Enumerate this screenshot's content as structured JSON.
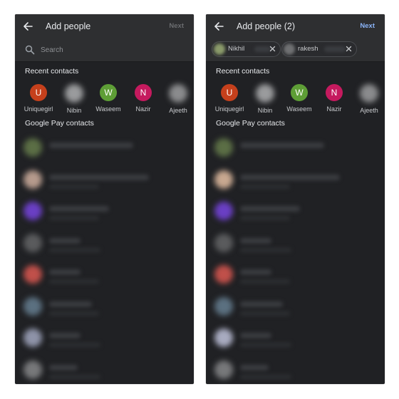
{
  "screens": [
    {
      "header": {
        "title": "Add people",
        "next_label": "Next",
        "next_enabled": false
      },
      "search": {
        "placeholder": "Search",
        "value": ""
      },
      "selected_chips": [],
      "recent_contacts_label": "Recent contacts",
      "recent_contacts": [
        {
          "name": "Uniquegirl",
          "initial": "U",
          "color": "#c5401c",
          "photo": false
        },
        {
          "name": "Nibin",
          "initial": "",
          "color": "#9a9b9d",
          "photo": true
        },
        {
          "name": "Waseem",
          "initial": "W",
          "color": "#5e9e36",
          "photo": false
        },
        {
          "name": "Nazir",
          "initial": "N",
          "color": "#c51a5e",
          "photo": false
        },
        {
          "name": "Ajeeth",
          "initial": "",
          "color": "#8a8b8d",
          "photo": true
        }
      ],
      "gpay_contacts_label": "Google Pay contacts",
      "gpay_contacts": [
        {
          "avatar_color": "#5b6e45",
          "blurred": true
        },
        {
          "avatar_color": "#b59a8c",
          "blurred": true
        },
        {
          "avatar_color": "#6a3fc4",
          "blurred": true
        },
        {
          "avatar_color": "#5a5b5d",
          "blurred": true
        },
        {
          "avatar_color": "#c0504a",
          "blurred": true
        },
        {
          "avatar_color": "#5b7080",
          "blurred": true
        },
        {
          "avatar_color": "#8e93a8",
          "blurred": true
        },
        {
          "avatar_color": "#77787a",
          "blurred": true
        }
      ]
    },
    {
      "header": {
        "title": "Add people (2)",
        "next_label": "Next",
        "next_enabled": true
      },
      "search": {
        "placeholder": "",
        "value": ""
      },
      "selected_chips": [
        {
          "name": "Nikhil",
          "avatar_color": "#8a9a6a"
        },
        {
          "name": "rakesh",
          "avatar_color": "#6f7072"
        }
      ],
      "recent_contacts_label": "Recent contacts",
      "recent_contacts": [
        {
          "name": "Uniquegirl",
          "initial": "U",
          "color": "#c5401c",
          "photo": false
        },
        {
          "name": "Nibin",
          "initial": "",
          "color": "#9a9b9d",
          "photo": true
        },
        {
          "name": "Waseem",
          "initial": "W",
          "color": "#5e9e36",
          "photo": false
        },
        {
          "name": "Nazir",
          "initial": "N",
          "color": "#c51a5e",
          "photo": false
        },
        {
          "name": "Ajeeth",
          "initial": "",
          "color": "#8a8b8d",
          "photo": true
        }
      ],
      "gpay_contacts_label": "Google Pay contacts",
      "gpay_contacts": [
        {
          "avatar_color": "#5b6e45",
          "blurred": true
        },
        {
          "avatar_color": "#c8a890",
          "blurred": true
        },
        {
          "avatar_color": "#6a3fc4",
          "blurred": true
        },
        {
          "avatar_color": "#5a5b5d",
          "blurred": true
        },
        {
          "avatar_color": "#c0504a",
          "blurred": true
        },
        {
          "avatar_color": "#5b7080",
          "blurred": true
        },
        {
          "avatar_color": "#a8abc0",
          "blurred": true
        },
        {
          "avatar_color": "#77787a",
          "blurred": true
        }
      ]
    }
  ]
}
